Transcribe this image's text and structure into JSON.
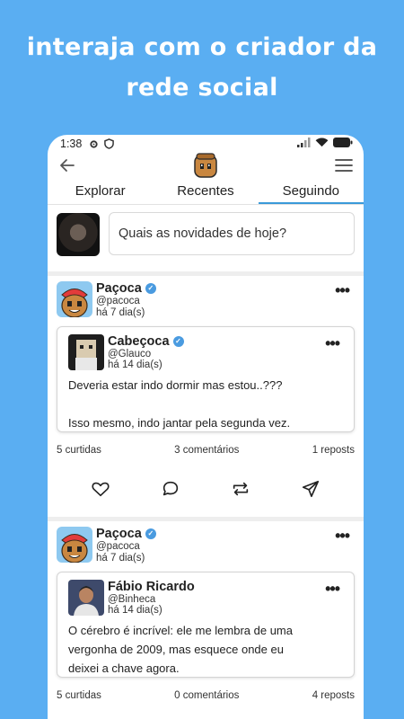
{
  "headline": {
    "line1": "interaja com o criador da",
    "line2": "rede social"
  },
  "status": {
    "time": "1:38"
  },
  "tabs": [
    {
      "label": "Explorar"
    },
    {
      "label": "Recentes"
    },
    {
      "label": "Seguindo",
      "active": true
    }
  ],
  "composer": {
    "placeholder": "Quais as novidades de hoje?"
  },
  "posts": [
    {
      "author": "Paçoca",
      "handle": "@pacoca",
      "time": "há 7 dia(s)",
      "quote": {
        "author": "Cabeçoca",
        "handle": "@Glauco",
        "time": "há 14 dia(s)",
        "text": "Deveria estar indo dormir mas estou..???\n\nIsso mesmo, indo jantar pela segunda vez."
      },
      "likes": "5 curtidas",
      "comments": "3 comentários",
      "reposts": "1 reposts"
    },
    {
      "author": "Paçoca",
      "handle": "@pacoca",
      "time": "há 7 dia(s)",
      "quote": {
        "author": "Fábio Ricardo",
        "handle": "@Binheca",
        "time": "há 14 dia(s)",
        "text": "O cérebro é incrível: ele me lembra de uma vergonha de 2009, mas esquece onde eu deixei a chave agora."
      },
      "likes": "5 curtidas",
      "comments": "0 comentários",
      "reposts": "4 reposts"
    }
  ],
  "colors": {
    "background": "#5aaef2",
    "accent": "#3a9ad9",
    "verified": "#4a9be0"
  }
}
